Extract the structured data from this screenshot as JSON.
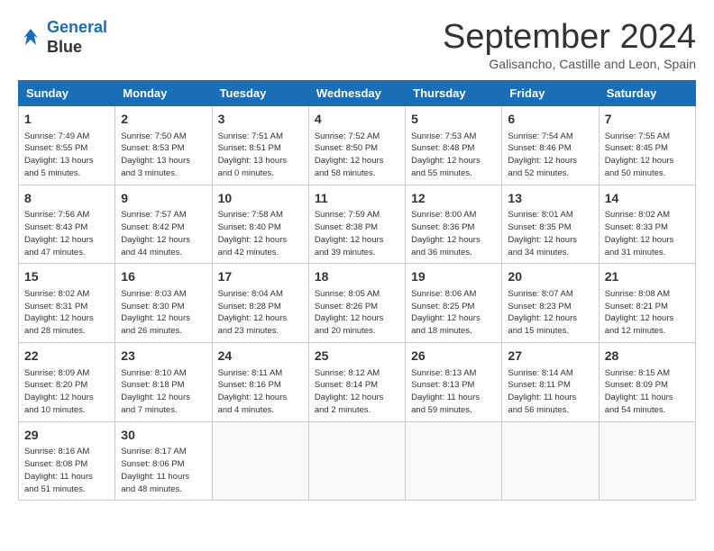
{
  "header": {
    "logo_line1": "General",
    "logo_line2": "Blue",
    "month_title": "September 2024",
    "location": "Galisancho, Castille and Leon, Spain"
  },
  "weekdays": [
    "Sunday",
    "Monday",
    "Tuesday",
    "Wednesday",
    "Thursday",
    "Friday",
    "Saturday"
  ],
  "weeks": [
    [
      {
        "day": "1",
        "info": "Sunrise: 7:49 AM\nSunset: 8:55 PM\nDaylight: 13 hours\nand 5 minutes."
      },
      {
        "day": "2",
        "info": "Sunrise: 7:50 AM\nSunset: 8:53 PM\nDaylight: 13 hours\nand 3 minutes."
      },
      {
        "day": "3",
        "info": "Sunrise: 7:51 AM\nSunset: 8:51 PM\nDaylight: 13 hours\nand 0 minutes."
      },
      {
        "day": "4",
        "info": "Sunrise: 7:52 AM\nSunset: 8:50 PM\nDaylight: 12 hours\nand 58 minutes."
      },
      {
        "day": "5",
        "info": "Sunrise: 7:53 AM\nSunset: 8:48 PM\nDaylight: 12 hours\nand 55 minutes."
      },
      {
        "day": "6",
        "info": "Sunrise: 7:54 AM\nSunset: 8:46 PM\nDaylight: 12 hours\nand 52 minutes."
      },
      {
        "day": "7",
        "info": "Sunrise: 7:55 AM\nSunset: 8:45 PM\nDaylight: 12 hours\nand 50 minutes."
      }
    ],
    [
      {
        "day": "8",
        "info": "Sunrise: 7:56 AM\nSunset: 8:43 PM\nDaylight: 12 hours\nand 47 minutes."
      },
      {
        "day": "9",
        "info": "Sunrise: 7:57 AM\nSunset: 8:42 PM\nDaylight: 12 hours\nand 44 minutes."
      },
      {
        "day": "10",
        "info": "Sunrise: 7:58 AM\nSunset: 8:40 PM\nDaylight: 12 hours\nand 42 minutes."
      },
      {
        "day": "11",
        "info": "Sunrise: 7:59 AM\nSunset: 8:38 PM\nDaylight: 12 hours\nand 39 minutes."
      },
      {
        "day": "12",
        "info": "Sunrise: 8:00 AM\nSunset: 8:36 PM\nDaylight: 12 hours\nand 36 minutes."
      },
      {
        "day": "13",
        "info": "Sunrise: 8:01 AM\nSunset: 8:35 PM\nDaylight: 12 hours\nand 34 minutes."
      },
      {
        "day": "14",
        "info": "Sunrise: 8:02 AM\nSunset: 8:33 PM\nDaylight: 12 hours\nand 31 minutes."
      }
    ],
    [
      {
        "day": "15",
        "info": "Sunrise: 8:02 AM\nSunset: 8:31 PM\nDaylight: 12 hours\nand 28 minutes."
      },
      {
        "day": "16",
        "info": "Sunrise: 8:03 AM\nSunset: 8:30 PM\nDaylight: 12 hours\nand 26 minutes."
      },
      {
        "day": "17",
        "info": "Sunrise: 8:04 AM\nSunset: 8:28 PM\nDaylight: 12 hours\nand 23 minutes."
      },
      {
        "day": "18",
        "info": "Sunrise: 8:05 AM\nSunset: 8:26 PM\nDaylight: 12 hours\nand 20 minutes."
      },
      {
        "day": "19",
        "info": "Sunrise: 8:06 AM\nSunset: 8:25 PM\nDaylight: 12 hours\nand 18 minutes."
      },
      {
        "day": "20",
        "info": "Sunrise: 8:07 AM\nSunset: 8:23 PM\nDaylight: 12 hours\nand 15 minutes."
      },
      {
        "day": "21",
        "info": "Sunrise: 8:08 AM\nSunset: 8:21 PM\nDaylight: 12 hours\nand 12 minutes."
      }
    ],
    [
      {
        "day": "22",
        "info": "Sunrise: 8:09 AM\nSunset: 8:20 PM\nDaylight: 12 hours\nand 10 minutes."
      },
      {
        "day": "23",
        "info": "Sunrise: 8:10 AM\nSunset: 8:18 PM\nDaylight: 12 hours\nand 7 minutes."
      },
      {
        "day": "24",
        "info": "Sunrise: 8:11 AM\nSunset: 8:16 PM\nDaylight: 12 hours\nand 4 minutes."
      },
      {
        "day": "25",
        "info": "Sunrise: 8:12 AM\nSunset: 8:14 PM\nDaylight: 12 hours\nand 2 minutes."
      },
      {
        "day": "26",
        "info": "Sunrise: 8:13 AM\nSunset: 8:13 PM\nDaylight: 11 hours\nand 59 minutes."
      },
      {
        "day": "27",
        "info": "Sunrise: 8:14 AM\nSunset: 8:11 PM\nDaylight: 11 hours\nand 56 minutes."
      },
      {
        "day": "28",
        "info": "Sunrise: 8:15 AM\nSunset: 8:09 PM\nDaylight: 11 hours\nand 54 minutes."
      }
    ],
    [
      {
        "day": "29",
        "info": "Sunrise: 8:16 AM\nSunset: 8:08 PM\nDaylight: 11 hours\nand 51 minutes."
      },
      {
        "day": "30",
        "info": "Sunrise: 8:17 AM\nSunset: 8:06 PM\nDaylight: 11 hours\nand 48 minutes."
      },
      {
        "day": "",
        "info": ""
      },
      {
        "day": "",
        "info": ""
      },
      {
        "day": "",
        "info": ""
      },
      {
        "day": "",
        "info": ""
      },
      {
        "day": "",
        "info": ""
      }
    ]
  ]
}
